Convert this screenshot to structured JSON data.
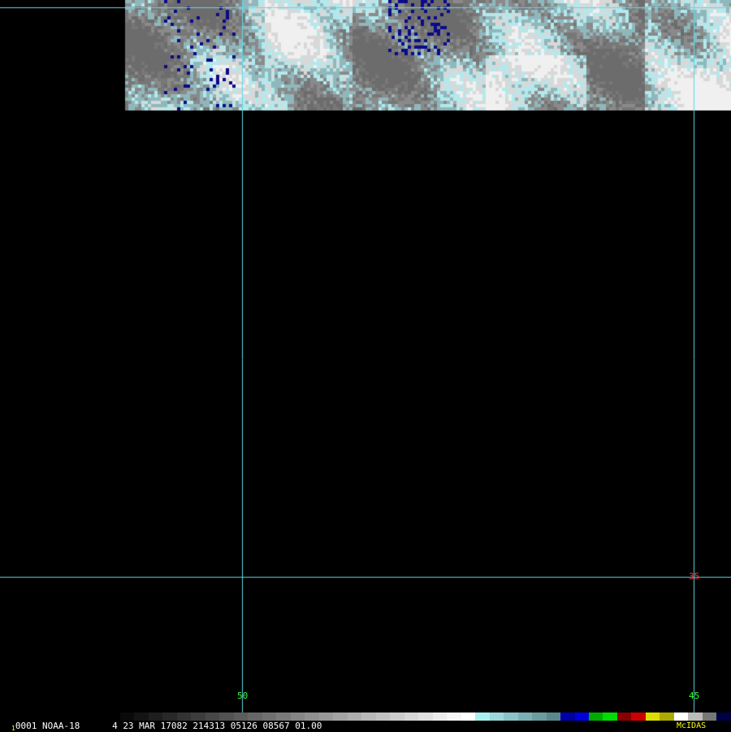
{
  "image": {
    "satellite_scene": "cloud imagery swath (partial, top of frame)",
    "gridline_color": "#5fd7e6"
  },
  "grid_labels": {
    "lon_left": "50",
    "lon_right": "45",
    "lat": "35",
    "lon_label_color": "#33ff33",
    "lat_label_color": "#ff3333"
  },
  "status_bar": {
    "frame_marker": "1",
    "frame_id": "0001",
    "satellite": "NOAA-18",
    "band": "4",
    "date": "23 MAR 17082",
    "time": "214313",
    "line": "05126",
    "element": "08567",
    "resolution": "01.00",
    "software": "McIDAS"
  },
  "colorbar": {
    "segments": [
      "#0a0a0a",
      "#141414",
      "#1e1e1e",
      "#282828",
      "#333333",
      "#3d3d3d",
      "#474747",
      "#525252",
      "#5c5c5c",
      "#666666",
      "#707070",
      "#7a7a7a",
      "#858585",
      "#8f8f8f",
      "#999999",
      "#a3a3a3",
      "#adadad",
      "#b8b8b8",
      "#c2c2c2",
      "#cccccc",
      "#d6d6d6",
      "#e0e0e0",
      "#ebebeb",
      "#f5f5f5",
      "#ffffff",
      "#aaf0f0",
      "#9ad8dc",
      "#8ac4c8",
      "#7ab0b4",
      "#6a9ca0",
      "#5a888c",
      "#0000aa",
      "#0000dd",
      "#00aa00",
      "#00dd00",
      "#880000",
      "#cc0000",
      "#dddd00",
      "#aaaa00",
      "#ffffff",
      "#bbbbbb",
      "#777777",
      "#000044"
    ]
  }
}
